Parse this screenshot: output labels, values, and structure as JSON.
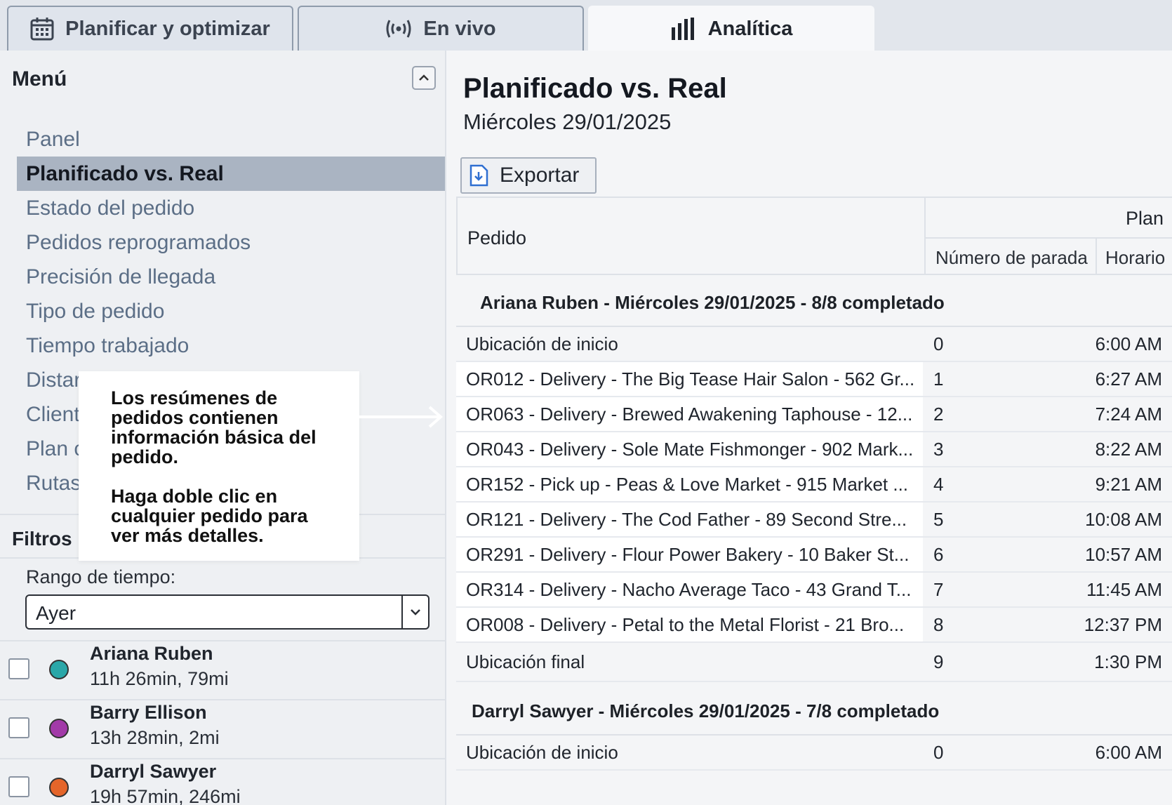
{
  "tabs": [
    {
      "label": "Planificar y optimizar",
      "icon": "calendar-icon",
      "active": false
    },
    {
      "label": "En vivo",
      "icon": "broadcast-icon",
      "active": false
    },
    {
      "label": "Analítica",
      "icon": "bar-chart-icon",
      "active": true
    }
  ],
  "sidebar": {
    "menu_title": "Menú",
    "items": [
      {
        "label": "Panel"
      },
      {
        "label": "Planificado vs. Real"
      },
      {
        "label": "Estado del pedido"
      },
      {
        "label": "Pedidos reprogramados"
      },
      {
        "label": "Precisión de llegada"
      },
      {
        "label": "Tipo de pedido"
      },
      {
        "label": "Tiempo trabajado"
      },
      {
        "label": "Distar"
      },
      {
        "label": "Client"
      },
      {
        "label": "Plan c"
      },
      {
        "label": "Rutas"
      }
    ],
    "filters_title": "Filtros",
    "range_label": "Rango de tiempo:",
    "range_value": "Ayer",
    "drivers": [
      {
        "name": "Ariana Ruben",
        "meta": "11h 26min, 79mi",
        "color": "#2aa7a8"
      },
      {
        "name": "Barry Ellison",
        "meta": "13h 28min, 2mi",
        "color": "#a23aa8"
      },
      {
        "name": "Darryl Sawyer",
        "meta": "19h 57min, 246mi",
        "color": "#e4652a"
      }
    ]
  },
  "main": {
    "title": "Planificado vs. Real",
    "date": "Miércoles 29/01/2025",
    "export_label": "Exportar",
    "table": {
      "col_order": "Pedido",
      "col_plan": "Plan",
      "col_stop": "Número de parada",
      "col_time": "Horario"
    },
    "groups": [
      {
        "header": "Ariana Ruben - Miércoles 29/01/2025 - 8/8 completado",
        "start": {
          "label": "Ubicación de inicio",
          "stop": "0",
          "time": "6:00 AM"
        },
        "rows": [
          {
            "order": "OR012 - Delivery - The Big Tease Hair Salon - 562 Gr...",
            "stop": "1",
            "time": "6:27 AM"
          },
          {
            "order": "OR063 - Delivery - Brewed Awakening Taphouse - 12...",
            "stop": "2",
            "time": "7:24 AM"
          },
          {
            "order": "OR043 - Delivery - Sole Mate Fishmonger - 902 Mark...",
            "stop": "3",
            "time": "8:22 AM"
          },
          {
            "order": "OR152 - Pick up - Peas & Love Market - 915 Market ...",
            "stop": "4",
            "time": "9:21 AM"
          },
          {
            "order": "OR121 - Delivery - The Cod Father - 89 Second Stre...",
            "stop": "5",
            "time": "10:08 AM"
          },
          {
            "order": "OR291 - Delivery - Flour Power Bakery - 10 Baker St...",
            "stop": "6",
            "time": "10:57 AM"
          },
          {
            "order": "OR314 - Delivery - Nacho Average Taco - 43 Grand T...",
            "stop": "7",
            "time": "11:45 AM"
          },
          {
            "order": "OR008 - Delivery - Petal to the Metal Florist - 21 Bro...",
            "stop": "8",
            "time": "12:37 PM"
          }
        ],
        "end": {
          "label": "Ubicación final",
          "stop": "9",
          "time": "1:30 PM"
        }
      },
      {
        "header": "Darryl Sawyer - Miércoles 29/01/2025 - 7/8 completado",
        "start": {
          "label": "Ubicación de inicio",
          "stop": "0",
          "time": "6:00 AM"
        }
      }
    ]
  },
  "callout": {
    "p1": "Los resúmenes de pedidos contienen información básica del pedido.",
    "p2": "Haga doble clic en cualquier pedido para ver más detalles."
  }
}
